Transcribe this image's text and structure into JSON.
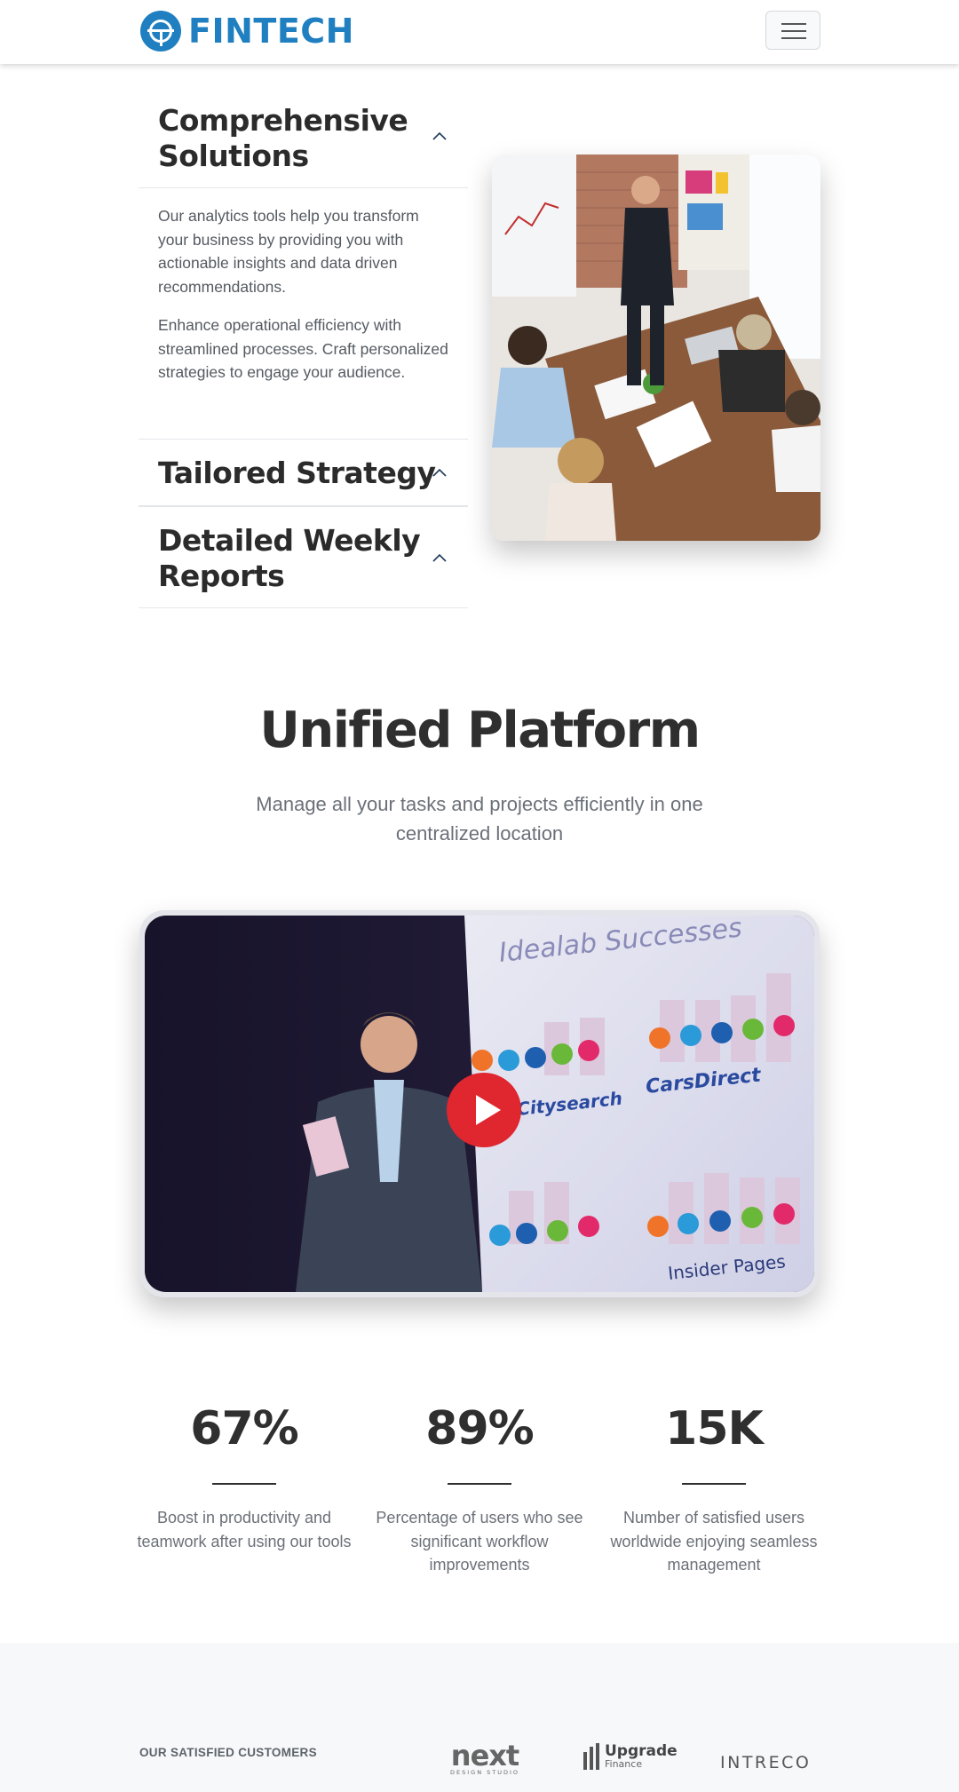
{
  "header": {
    "brand": "FINTECH",
    "logo_icon": "fintech-globe-icon",
    "menu_icon": "hamburger-icon",
    "brand_color": "#1f7fc0"
  },
  "accordion": {
    "items": [
      {
        "title_line1": "Comprehensive",
        "title_line2": "Solutions",
        "expanded": true,
        "paragraphs": [
          "Our analytics tools help you transform your business by providing you with actionable insights and data driven recommendations.",
          "Enhance operational efficiency with streamlined processes. Craft personalized strategies to engage your audience."
        ]
      },
      {
        "title_line1": "Tailored Strategy",
        "expanded": false
      },
      {
        "title_line1": "Detailed Weekly",
        "title_line2": "Reports",
        "expanded": false
      }
    ],
    "chevron_icon": "chevron-up-icon"
  },
  "feature_image": {
    "alt": "Team meeting around a table with presenter at whiteboard"
  },
  "platform": {
    "title": "Unified Platform",
    "subtitle": "Manage all your tasks and projects efficiently in one centralized location",
    "video": {
      "slide_title": "Idealab Successes",
      "slide_logos": [
        "Citysearch",
        "CarsDirect",
        "Insider Pages"
      ],
      "play_icon": "play-icon",
      "play_color": "#e0262e"
    }
  },
  "stats": [
    {
      "value": "67%",
      "text": "Boost in productivity and teamwork after using our tools"
    },
    {
      "value": "89%",
      "text": "Percentage of users who see significant workflow improvements"
    },
    {
      "value": "15K",
      "text": "Number of satisfied users worldwide enjoying seamless management"
    }
  ],
  "customers": {
    "label": "OUR SATISFIED CUSTOMERS",
    "logos": [
      {
        "name": "next",
        "sub": "DESIGN STUDIO"
      },
      {
        "name": "Upgrade",
        "sub": "Finance"
      },
      {
        "name": "INTRECO"
      }
    ]
  }
}
